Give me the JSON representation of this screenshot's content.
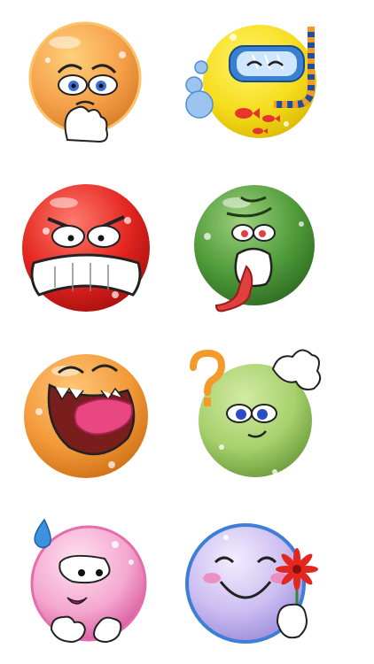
{
  "palette": {
    "background": "#ffffff",
    "outline": "#1a1a1a",
    "glove": "#ffffff"
  },
  "emojis": [
    {
      "id": "worried",
      "icon": "worried-face-icon",
      "colors": {
        "light": "#ffd07a",
        "base": "#f6a14b",
        "dark": "#d97d27"
      }
    },
    {
      "id": "snorkel",
      "icon": "snorkel-face-icon",
      "colors": {
        "light": "#fff36a",
        "base": "#f7dd1e",
        "dark": "#d9b800",
        "mask": "#3a7fd0",
        "fish": "#e6352b"
      }
    },
    {
      "id": "angry",
      "icon": "angry-face-icon",
      "colors": {
        "light": "#ff7b6e",
        "base": "#e3251f",
        "dark": "#a80f0f"
      }
    },
    {
      "id": "sick",
      "icon": "sick-face-icon",
      "colors": {
        "light": "#9fd07f",
        "base": "#4f9b3a",
        "dark": "#2e6b22",
        "tongue": "#e0413f"
      }
    },
    {
      "id": "laughing",
      "icon": "laughing-face-icon",
      "colors": {
        "light": "#ffc77a",
        "base": "#f39a3a",
        "dark": "#cf6f14",
        "tongue": "#e8477f"
      }
    },
    {
      "id": "confused",
      "icon": "confused-face-icon",
      "colors": {
        "light": "#d3eaa4",
        "base": "#a6d16c",
        "dark": "#6a9b3b",
        "question": "#f39a2b"
      }
    },
    {
      "id": "shy",
      "icon": "shy-face-icon",
      "colors": {
        "light": "#ffe1f0",
        "base": "#f4a8cf",
        "dark": "#d7579d",
        "drop": "#3d92e0"
      }
    },
    {
      "id": "flower",
      "icon": "flower-face-icon",
      "colors": {
        "light": "#f3edff",
        "base": "#cbbdf1",
        "dark": "#3d7fd4",
        "flower": "#e3261f"
      }
    }
  ]
}
